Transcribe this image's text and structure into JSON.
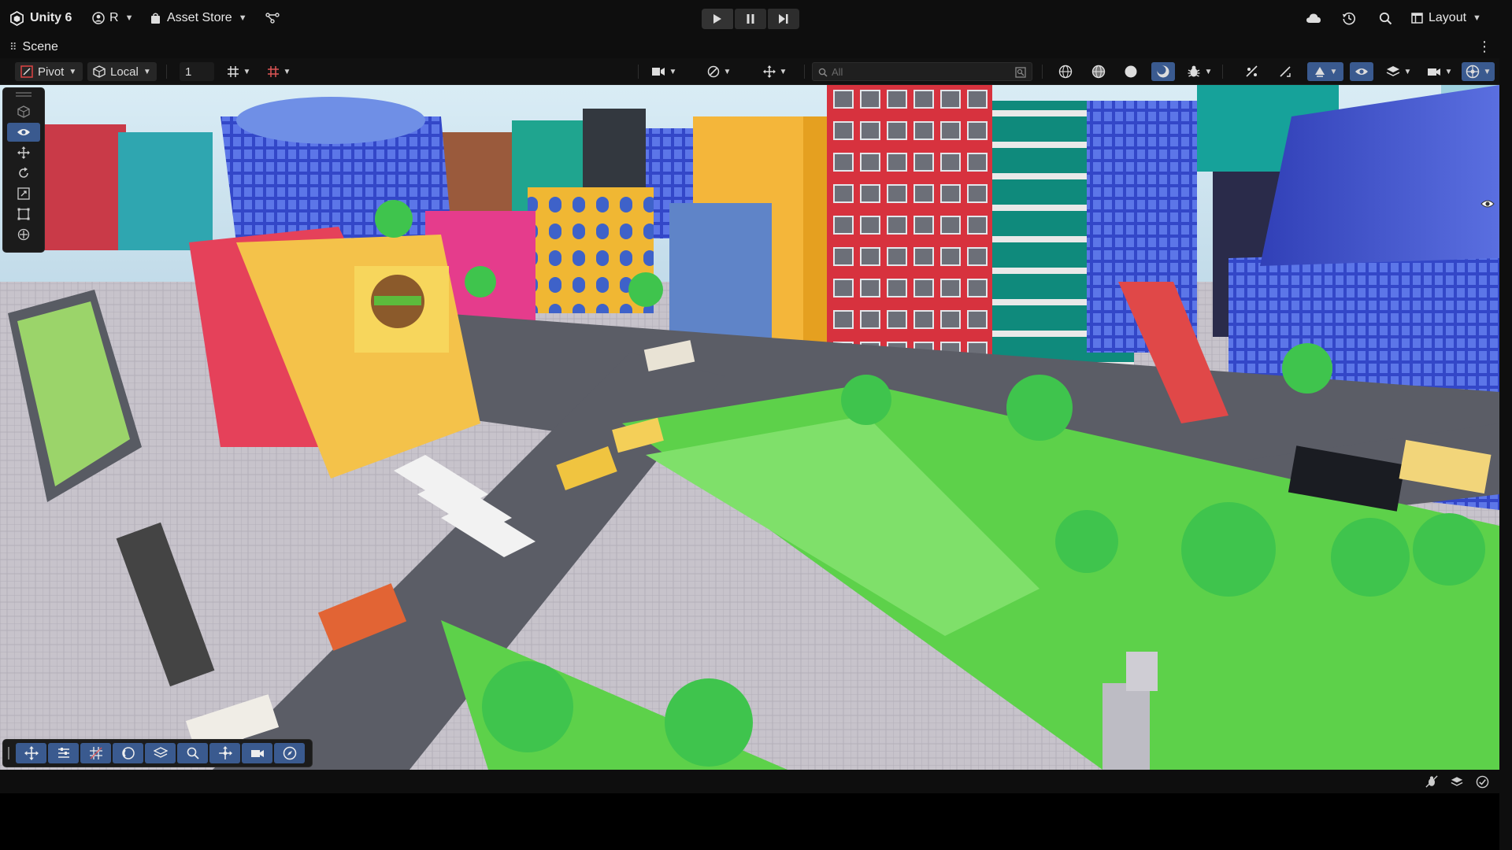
{
  "app": {
    "name": "Unity 6",
    "account_label": "R",
    "asset_store_label": "Asset Store"
  },
  "playmode": {
    "play_label": "Play",
    "pause_label": "Pause",
    "step_label": "Step"
  },
  "top_right": {
    "icons": [
      "cloud-icon",
      "history-icon",
      "search-icon"
    ],
    "layout_label": "Layout"
  },
  "scene_tab": {
    "title": "Scene"
  },
  "scene_toolbar": {
    "pivot_label": "Pivot",
    "space_label": "Local",
    "grid_snap_value": "1",
    "search_placeholder": "All",
    "shading_modes": [
      "wireframe-icon",
      "shaded-wireframe-icon",
      "shaded-icon",
      "lit-icon"
    ]
  },
  "tool_palette": {
    "tools": [
      "view-tool-icon",
      "move-tool-icon",
      "rotate-tool-icon",
      "scale-tool-icon",
      "rect-tool-icon",
      "transform-tool-icon"
    ],
    "selected": "view-tool-icon"
  },
  "overlay_bar": {
    "tools": [
      "move-icon",
      "align-icon",
      "grid-icon",
      "orbit-icon",
      "layers-icon",
      "zoom-icon",
      "pan-icon",
      "camera-icon",
      "compass-icon"
    ]
  },
  "status_bar": {
    "icons": [
      "bug-icon",
      "layers-icon",
      "check-icon"
    ]
  },
  "colors": {
    "chrome_bg": "#0e0e0e",
    "toolbar_bg": "#111111",
    "accent_blue": "#3a5a8f",
    "button_bg": "#262626"
  }
}
